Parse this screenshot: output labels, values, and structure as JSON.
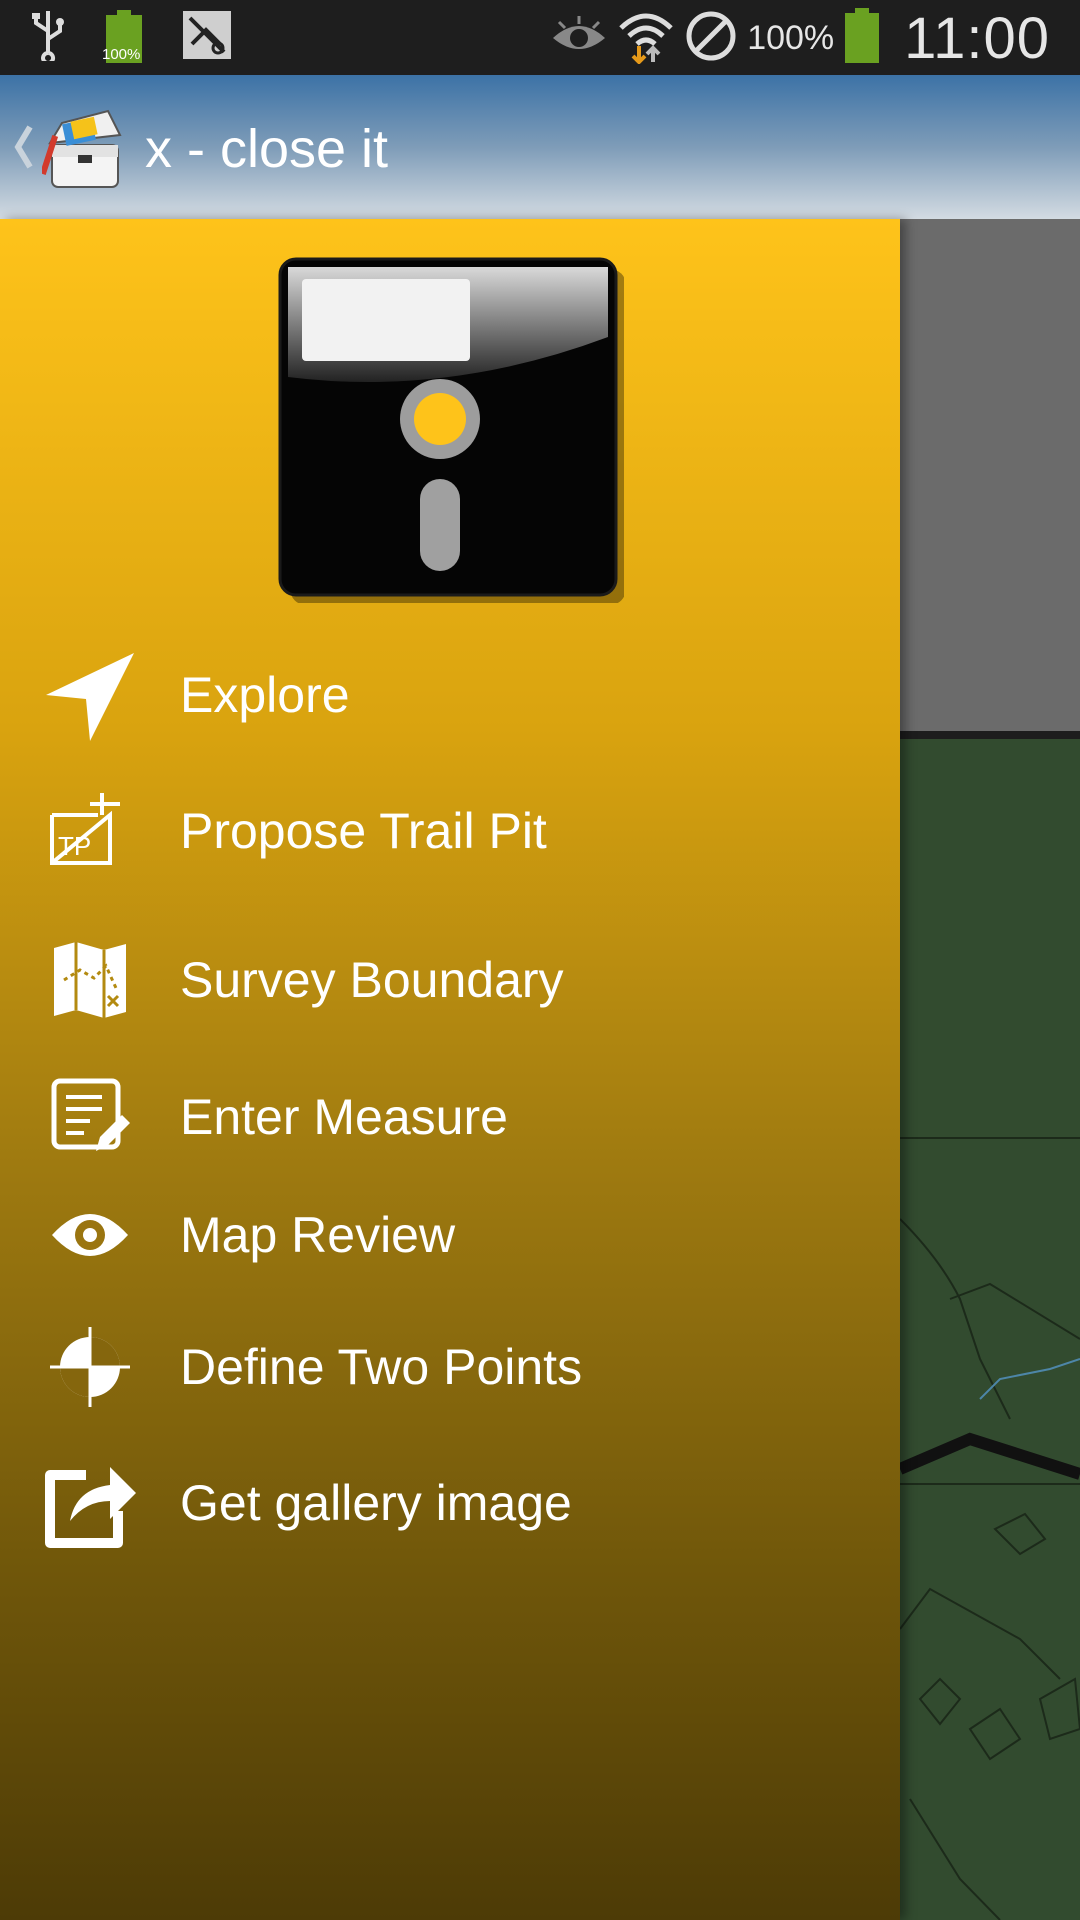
{
  "status_bar": {
    "battery_small_label": "100%",
    "battery_percent": "100%",
    "time": "11:00",
    "icons": [
      "usb-icon",
      "battery-icon",
      "screenshot-icon",
      "eye-icon",
      "wifi-icon",
      "no-sync-icon",
      "battery-icon"
    ]
  },
  "action_bar": {
    "title": "x - close it",
    "icon": "toolbox-icon"
  },
  "drawer": {
    "header_icon": "floppy-disk-icon",
    "items": [
      {
        "label": "Explore",
        "icon": "navigation-arrow-icon"
      },
      {
        "label": "Propose Trail Pit",
        "icon": "trail-pit-add-icon"
      },
      {
        "label": "Survey Boundary",
        "icon": "map-icon"
      },
      {
        "label": "Enter Measure",
        "icon": "edit-list-icon"
      },
      {
        "label": "Map Review",
        "icon": "eye-icon"
      },
      {
        "label": "Define Two Points",
        "icon": "crosshair-icon"
      },
      {
        "label": "Get gallery image",
        "icon": "share-external-icon"
      }
    ]
  },
  "colors": {
    "drawer_top": "#fec31a",
    "drawer_bottom": "#4d3b06",
    "action_bar_top": "#3c72a6",
    "map_green": "#324b2f",
    "map_gray": "#6b6b6b"
  }
}
